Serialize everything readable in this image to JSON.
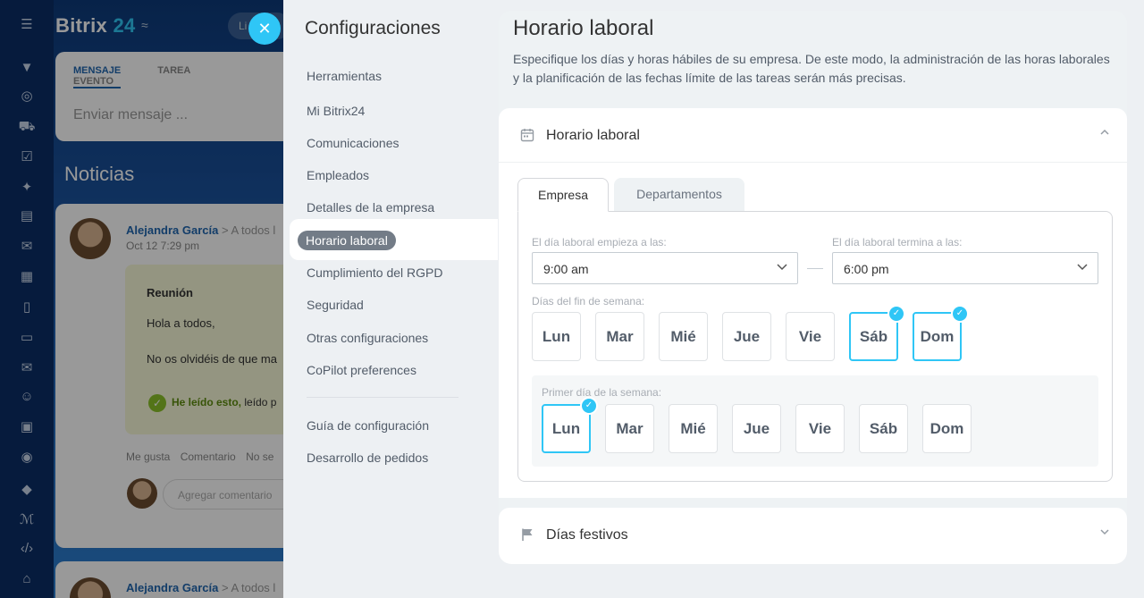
{
  "background": {
    "brand_name": "Bitrix",
    "brand_number": "24",
    "brand_suffix": "≈",
    "pill_label": "Li",
    "composer": {
      "tabs": [
        "MENSAJE",
        "TAREA",
        "EVENTO"
      ],
      "placeholder": "Enviar mensaje ..."
    },
    "feed_title": "Noticias",
    "post": {
      "author": "Alejandra García",
      "recipient": "> A todos l",
      "date": "Oct 12 7:29 pm",
      "title": "Reunión",
      "line1": "Hola a todos,",
      "line2": "No os olvidéis de que ma",
      "read_label": "He leído esto,",
      "read_suffix": "leído p",
      "actions": [
        "Me gusta",
        "Comentario",
        "No se"
      ],
      "comment_placeholder": "Agregar comentario"
    },
    "post2": {
      "author": "Alejandra García",
      "recipient": "> A todos l"
    }
  },
  "settings_nav": {
    "title": "Configuraciones",
    "items": [
      "Herramientas",
      "Mi Bitrix24",
      "Comunicaciones",
      "Empleados",
      "Detalles de la empresa",
      "Horario laboral",
      "Cumplimiento del RGPD",
      "Seguridad",
      "Otras configuraciones",
      "CoPilot preferences"
    ],
    "active_item": "Horario laboral",
    "secondary_items": [
      "Guía de configuración",
      "Desarrollo de pedidos"
    ]
  },
  "panel": {
    "title": "Horario laboral",
    "description": "Especifique los días y horas hábiles de su empresa. De este modo, la administración de las horas laborales y la planificación de las fechas límite de las tareas serán más precisas.",
    "section": {
      "title": "Horario laboral",
      "tabs": {
        "active": "Empresa",
        "inactive": "Departamentos"
      },
      "start_label": "El día laboral empieza a las:",
      "start_value": "9:00 am",
      "end_label": "El día laboral termina a las:",
      "end_value": "6:00 pm",
      "weekend_label": "Días del fin de semana:",
      "days": [
        "Lun",
        "Mar",
        "Mié",
        "Jue",
        "Vie",
        "Sáb",
        "Dom"
      ],
      "weekend_selected": [
        "Sáb",
        "Dom"
      ],
      "first_day_label": "Primer día de la semana:",
      "first_day_selected": "Lun"
    },
    "holidays_title": "Días festivos"
  },
  "colors": {
    "accent": "#2fc6f6",
    "nav_pill": "#737c87",
    "link": "#2067b0"
  }
}
